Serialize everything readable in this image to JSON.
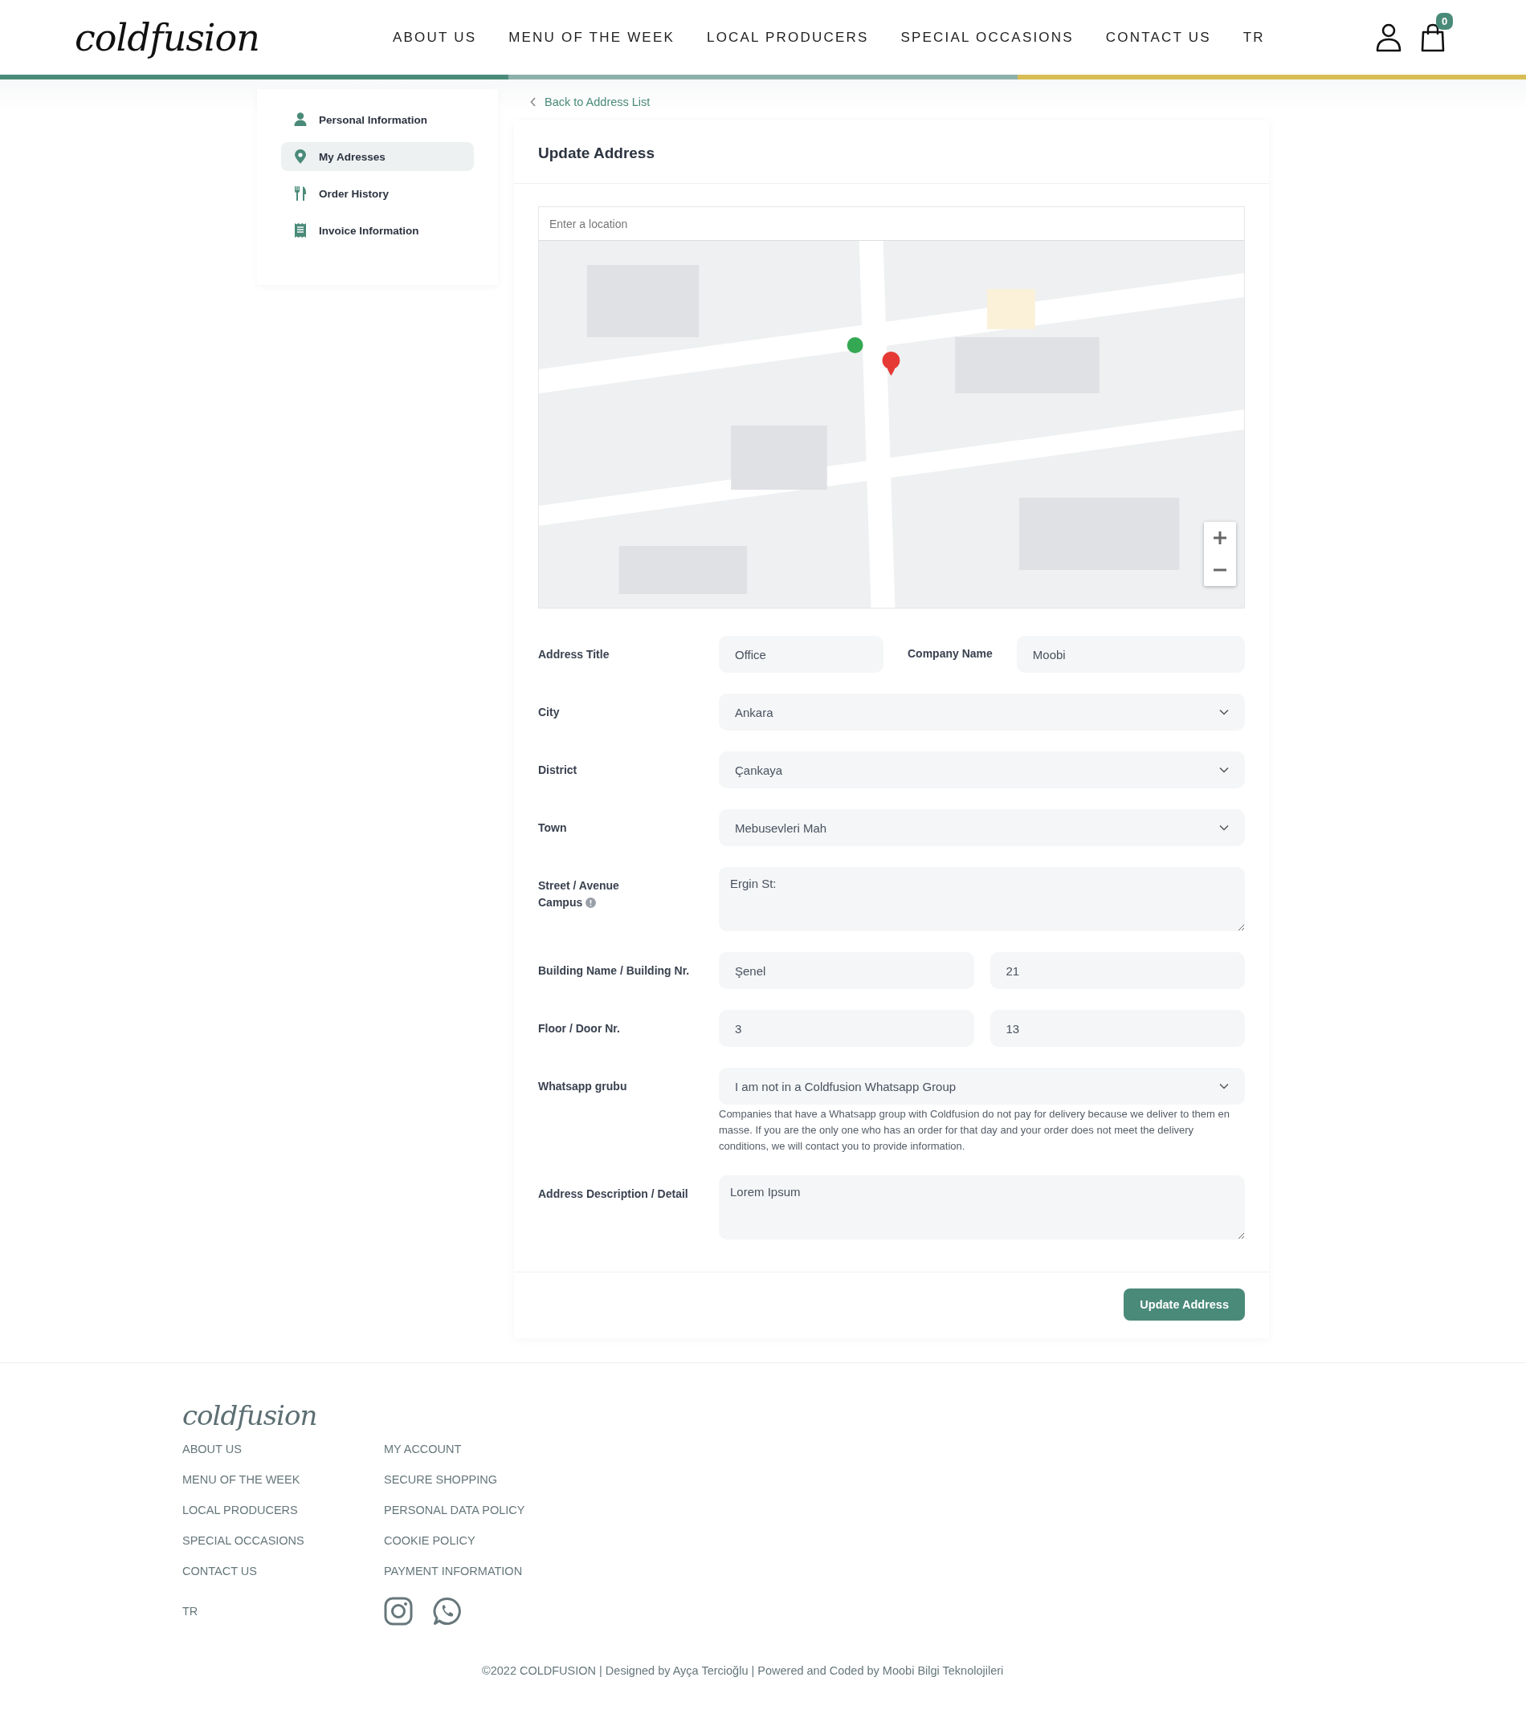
{
  "header": {
    "logo": "coldfusion",
    "nav": [
      {
        "label": "ABOUT US"
      },
      {
        "label": "MENU OF THE WEEK"
      },
      {
        "label": "LOCAL PRODUCERS"
      },
      {
        "label": "SPECIAL OCCASIONS"
      },
      {
        "label": "CONTACT US"
      },
      {
        "label": "TR"
      }
    ],
    "cart_count": "0"
  },
  "sidebar": {
    "items": [
      {
        "label": "Personal Information",
        "kind": "person",
        "selected": false
      },
      {
        "label": "My Adresses",
        "kind": "pin",
        "selected": true
      },
      {
        "label": "Order History",
        "kind": "cutlery",
        "selected": false
      },
      {
        "label": "Invoice Information",
        "kind": "receipt",
        "selected": false
      }
    ]
  },
  "back_link": "Back to Address List",
  "card": {
    "title": "Update Address",
    "map": {
      "kind": "picture",
      "search": {
        "placeholder": "Enter a location"
      }
    },
    "rows": [
      {
        "kind": "split",
        "label": "Address Title",
        "value": "Office",
        "label_2": "Company Name",
        "value_2": "Moobi"
      },
      {
        "kind": "select",
        "label": "City",
        "value": "Ankara"
      },
      {
        "kind": "select",
        "label": "District",
        "value": "Çankaya"
      },
      {
        "kind": "select",
        "label": "Town",
        "value": "Mebusevleri Mah"
      },
      {
        "kind": "textarea",
        "label": "Street / Avenue Campus",
        "info": true,
        "value": "Ergin St:"
      },
      {
        "kind": "pair",
        "label": "Building Name / Building Nr.",
        "values": [
          "Şenel",
          "21"
        ]
      },
      {
        "kind": "pair",
        "label": "Floor / Door Nr.",
        "values": [
          "3",
          "13"
        ]
      },
      {
        "kind": "select",
        "label": "Whatsapp grubu",
        "value": "I am not in a Coldfusion Whatsapp Group",
        "help": "Companies that have a Whatsapp group with Coldfusion do not pay for delivery because we deliver to them en masse. If you are the only one who has an order for that day and your order does not meet the delivery conditions, we will contact you to provide information."
      },
      {
        "kind": "textarea",
        "label": "Address Description / Detail",
        "value": "Lorem Ipsum"
      }
    ],
    "submit": "Update Address"
  },
  "footer": {
    "logo": "coldfusion",
    "column_1": [
      "ABOUT US",
      "MENU OF THE WEEK",
      "LOCAL PRODUCERS",
      "SPECIAL OCCASIONS",
      "CONTACT US"
    ],
    "column_2": [
      "MY ACCOUNT",
      "SECURE SHOPPING",
      "PERSONAL DATA POLICY",
      "COOKIE POLICY",
      "PAYMENT INFORMATION"
    ],
    "language": "TR",
    "copyright": "©2022 COLDFUSION | Designed by Ayça Tercioğlu | Powered and Coded by Moobi Bilgi Teknolojileri"
  }
}
